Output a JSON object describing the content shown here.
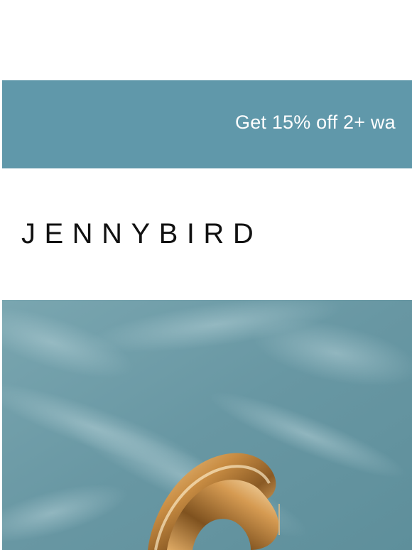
{
  "promo": {
    "text": "Get 15% off 2+ wa"
  },
  "brand": {
    "name": "JENNYBIRD"
  },
  "hero": {
    "image_subject": "gold-hoop-earrings-icon"
  },
  "colors": {
    "banner": "#6098aa",
    "hero_background": "#6c9aa5",
    "logo": "#111111",
    "gold": "#c8954a"
  }
}
